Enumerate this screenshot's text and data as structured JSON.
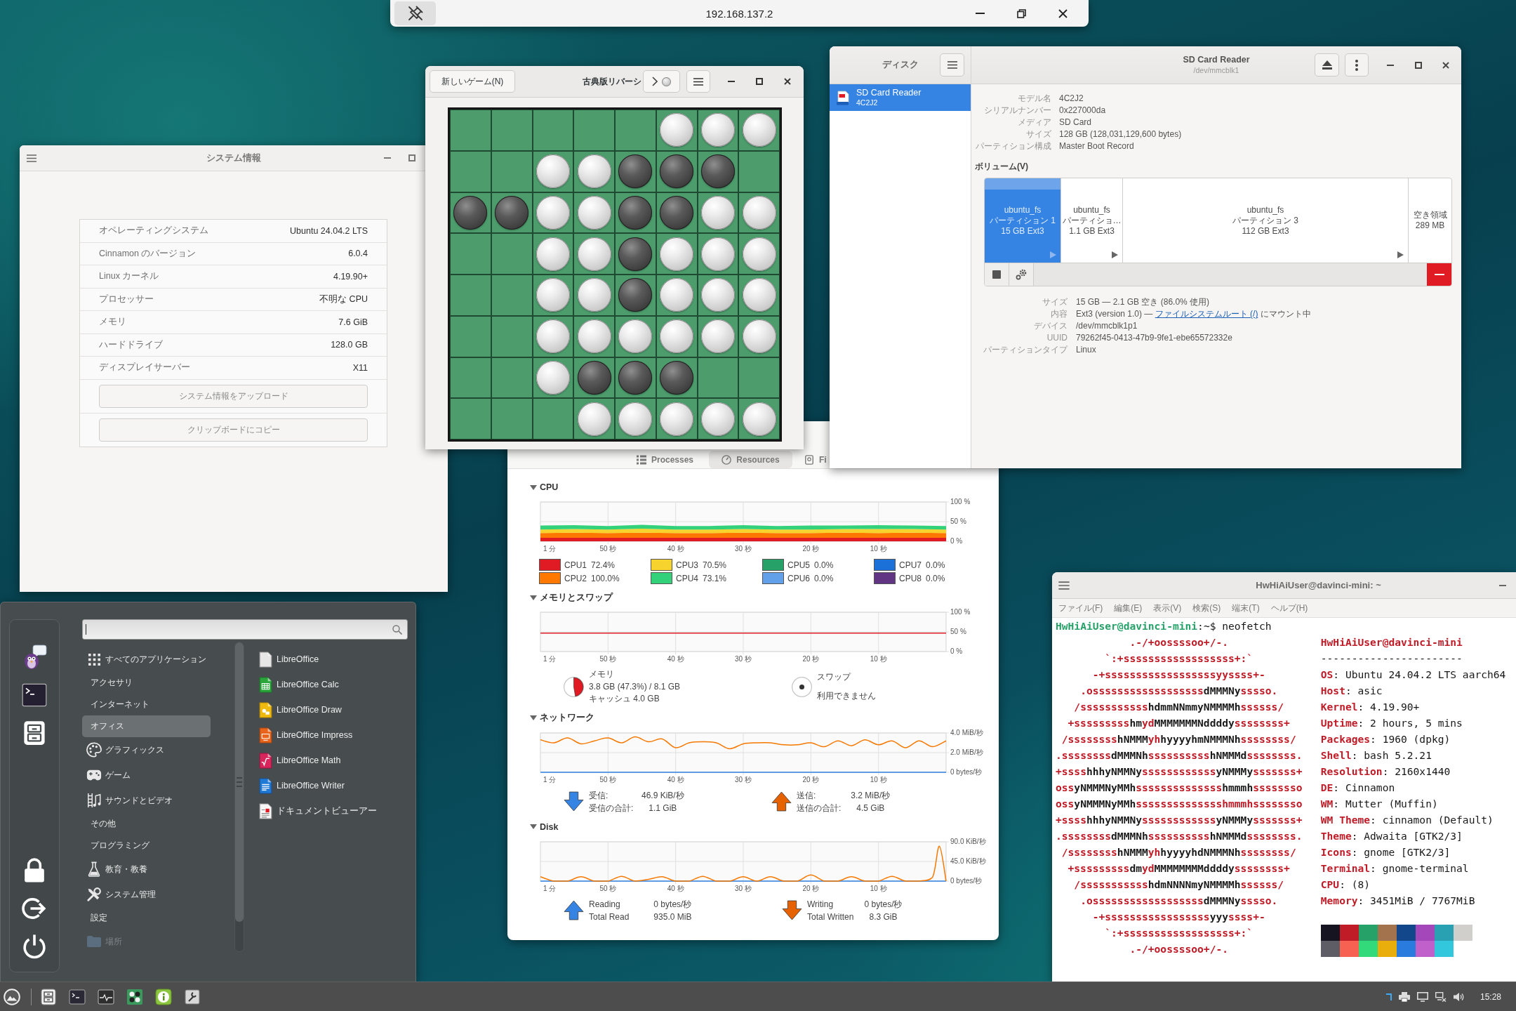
{
  "remote_bar": {
    "title": "192.168.137.2"
  },
  "system_info": {
    "title": "システム情報",
    "rows": [
      {
        "label": "オペレーティングシステム",
        "value": "Ubuntu 24.04.2 LTS"
      },
      {
        "label": "Cinnamon のバージョン",
        "value": "6.0.4"
      },
      {
        "label": "Linux カーネル",
        "value": "4.19.90+"
      },
      {
        "label": "プロセッサー",
        "value": "不明な CPU"
      },
      {
        "label": "メモリ",
        "value": "7.6 GiB"
      },
      {
        "label": "ハードドライブ",
        "value": "128.0 GB"
      },
      {
        "label": "ディスプレイサーバー",
        "value": "X11"
      }
    ],
    "buttons": [
      "システム情報をアップロード",
      "クリップボードにコピー"
    ]
  },
  "reversi": {
    "new_game_button": "新しいゲーム(N)",
    "title": "古典版リバーシ",
    "turn": {
      "kind": "white"
    },
    "board": [
      [
        {
          "kind": "empty"
        },
        {
          "kind": "empty"
        },
        {
          "kind": "empty"
        },
        {
          "kind": "empty"
        },
        {
          "kind": "empty"
        },
        {
          "kind": "white"
        },
        {
          "kind": "white"
        },
        {
          "kind": "white"
        }
      ],
      [
        {
          "kind": "empty"
        },
        {
          "kind": "empty"
        },
        {
          "kind": "white"
        },
        {
          "kind": "white"
        },
        {
          "kind": "black"
        },
        {
          "kind": "black"
        },
        {
          "kind": "black"
        },
        {
          "kind": "empty"
        }
      ],
      [
        {
          "kind": "black"
        },
        {
          "kind": "black"
        },
        {
          "kind": "white"
        },
        {
          "kind": "white"
        },
        {
          "kind": "black"
        },
        {
          "kind": "black"
        },
        {
          "kind": "white"
        },
        {
          "kind": "white"
        }
      ],
      [
        {
          "kind": "empty"
        },
        {
          "kind": "empty"
        },
        {
          "kind": "white"
        },
        {
          "kind": "white"
        },
        {
          "kind": "black"
        },
        {
          "kind": "white"
        },
        {
          "kind": "white"
        },
        {
          "kind": "white"
        }
      ],
      [
        {
          "kind": "empty"
        },
        {
          "kind": "empty"
        },
        {
          "kind": "white"
        },
        {
          "kind": "white"
        },
        {
          "kind": "black"
        },
        {
          "kind": "white"
        },
        {
          "kind": "white"
        },
        {
          "kind": "white"
        }
      ],
      [
        {
          "kind": "empty"
        },
        {
          "kind": "empty"
        },
        {
          "kind": "white"
        },
        {
          "kind": "white"
        },
        {
          "kind": "white"
        },
        {
          "kind": "white"
        },
        {
          "kind": "white"
        },
        {
          "kind": "white"
        }
      ],
      [
        {
          "kind": "empty"
        },
        {
          "kind": "empty"
        },
        {
          "kind": "white"
        },
        {
          "kind": "black"
        },
        {
          "kind": "black"
        },
        {
          "kind": "black"
        },
        {
          "kind": "empty"
        },
        {
          "kind": "empty"
        }
      ],
      [
        {
          "kind": "empty"
        },
        {
          "kind": "empty"
        },
        {
          "kind": "empty"
        },
        {
          "kind": "white"
        },
        {
          "kind": "white"
        },
        {
          "kind": "white"
        },
        {
          "kind": "white"
        },
        {
          "kind": "white"
        }
      ]
    ]
  },
  "disks": {
    "sidebar_title": "ディスク",
    "drives": [
      {
        "name": "SD Card Reader",
        "model": "4C2J2",
        "selected": true
      }
    ],
    "title": "SD Card Reader",
    "subtitle": "/dev/mmcblk1",
    "info": [
      {
        "label": "モデル名",
        "value": "4C2J2"
      },
      {
        "label": "シリアルナンバー",
        "value": "0x227000da"
      },
      {
        "label": "メディア",
        "value": "SD Card"
      },
      {
        "label": "サイズ",
        "value": "128 GB (128,031,129,600 bytes)"
      },
      {
        "label": "パーティション構成",
        "value": "Master Boot Record"
      }
    ],
    "volumes_heading": "ボリューム(V)",
    "partitions": [
      {
        "kind": "partition",
        "name": "ubuntu_fs",
        "label": "パーティション 1",
        "size": "15 GB Ext3",
        "selected": true
      },
      {
        "kind": "partition",
        "name": "ubuntu_fs",
        "label": "パーティショ…",
        "size": "1.1 GB Ext3",
        "selected": false
      },
      {
        "kind": "partition",
        "name": "ubuntu_fs",
        "label": "パーティション 3",
        "size": "112 GB Ext3",
        "selected": false
      },
      {
        "kind": "free",
        "label": "空き領域",
        "size": "289 MB",
        "selected": false
      }
    ],
    "details": [
      {
        "label": "サイズ",
        "value": "15 GB — 2.1 GB 空き (86.0% 使用)"
      },
      {
        "label": "内容",
        "value": "Ext3 (version 1.0) — ",
        "link": "ファイルシステムルート (/)",
        "suffix": " にマウント中"
      },
      {
        "label": "デバイス",
        "value": "/dev/mmcblk1p1"
      },
      {
        "label": "UUID",
        "value": "79262f45-0413-47b9-9fe1-ebe65572332e"
      },
      {
        "label": "パーティションタイプ",
        "value": "Linux"
      }
    ]
  },
  "system_monitor": {
    "tabs": [
      {
        "label": "Processes",
        "selected": false
      },
      {
        "label": "Resources",
        "selected": true
      },
      {
        "label": "Fi",
        "selected": false
      }
    ],
    "sections": [
      {
        "kind": "cpu",
        "title": "CPU",
        "expanded": true,
        "x_axis_start": "1 分",
        "chart_data": {
          "type": "area",
          "stacked": true,
          "grid": true,
          "x": [
            60,
            55,
            50,
            45,
            40,
            35,
            30,
            25,
            20,
            15,
            10,
            5,
            0
          ],
          "series": [
            {
              "color": "#33d17a",
              "values": [
                10,
                10,
                9,
                10,
                9,
                9,
                10,
                9,
                10,
                9,
                10,
                9,
                9
              ]
            },
            {
              "color": "#f6d32d",
              "values": [
                9,
                9,
                9,
                10,
                9,
                9,
                9,
                9,
                9,
                9,
                10,
                9,
                9
              ]
            },
            {
              "color": "#ff7800",
              "values": [
                12,
                13,
                12,
                13,
                12,
                12,
                13,
                12,
                12,
                13,
                12,
                13,
                12
              ]
            },
            {
              "color": "#e01b24",
              "values": [
                9,
                9,
                9,
                9,
                9,
                9,
                9,
                9,
                9,
                9,
                9,
                9,
                9
              ]
            }
          ],
          "xlim": [
            60,
            0
          ],
          "ylim": [
            0,
            100
          ],
          "xticks": [
            {
              "value": 50,
              "label": "50 秒"
            },
            {
              "value": 40,
              "label": "40 秒"
            },
            {
              "value": 30,
              "label": "30 秒"
            },
            {
              "value": 20,
              "label": "20 秒"
            },
            {
              "value": 10,
              "label": "10 秒"
            }
          ],
          "yticks": [
            {
              "value": 100,
              "label": "100 %"
            },
            {
              "value": 50,
              "label": "50 %"
            },
            {
              "value": 0,
              "label": "0 %"
            }
          ]
        },
        "legend": [
          {
            "name": "CPU1",
            "color": "#e01b24",
            "reading": "72.4%"
          },
          {
            "name": "CPU2",
            "color": "#ff7800",
            "reading": "100.0%"
          },
          {
            "name": "CPU3",
            "color": "#f6d32d",
            "reading": "70.5%"
          },
          {
            "name": "CPU4",
            "color": "#33d17a",
            "reading": "73.1%"
          },
          {
            "name": "CPU5",
            "color": "#26a269",
            "reading": "0.0%"
          },
          {
            "name": "CPU6",
            "color": "#62a0ea",
            "reading": "0.0%"
          },
          {
            "name": "CPU7",
            "color": "#1c71d8",
            "reading": "0.0%"
          },
          {
            "name": "CPU8",
            "color": "#613583",
            "reading": "0.0%"
          }
        ]
      },
      {
        "kind": "memory",
        "title": "メモリとスワップ",
        "expanded": true,
        "x_axis_start": "1 分",
        "chart_data": {
          "type": "line",
          "grid": true,
          "x": [
            60,
            0
          ],
          "series": [
            {
              "color": "#e01b24",
              "values": [
                47,
                47
              ]
            }
          ],
          "xlim": [
            60,
            0
          ],
          "ylim": [
            0,
            100
          ],
          "xticks": [
            {
              "value": 50,
              "label": "50 秒"
            },
            {
              "value": 40,
              "label": "40 秒"
            },
            {
              "value": 30,
              "label": "30 秒"
            },
            {
              "value": 20,
              "label": "20 秒"
            },
            {
              "value": 10,
              "label": "10 秒"
            }
          ],
          "yticks": [
            {
              "value": 100,
              "label": "100 %"
            },
            {
              "value": 50,
              "label": "50 %"
            },
            {
              "value": 0,
              "label": "0 %"
            }
          ]
        },
        "legend": [
          {
            "title": "メモリ",
            "lines": [
              "3.8 GB (47.3%) / 8.1 GB",
              "キャッシュ 4.0 GB"
            ],
            "level": 0.473,
            "color": "#e01b24"
          },
          {
            "title": "スワップ",
            "lines": [
              "利用できません"
            ]
          }
        ]
      },
      {
        "kind": "network",
        "title": "ネットワーク",
        "expanded": true,
        "x_axis_start": "1 分",
        "chart_data": {
          "type": "line",
          "grid": true,
          "x": [
            60,
            58,
            56,
            54,
            52,
            50,
            48,
            46,
            44,
            42,
            40,
            38,
            36,
            34,
            32,
            30,
            28,
            26,
            24,
            22,
            20,
            18,
            16,
            14,
            12,
            10,
            8,
            6,
            4,
            2,
            0
          ],
          "series": [
            {
              "color": "#3584e4",
              "values": [
                0,
                0,
                0,
                0,
                0,
                0,
                0,
                0,
                0,
                0,
                0,
                0,
                0,
                0,
                0,
                0,
                0,
                0,
                0,
                0,
                0,
                0,
                0,
                0,
                0,
                0,
                0,
                0,
                0,
                0,
                0
              ]
            },
            {
              "color": "#f57900",
              "values": [
                3.3,
                3.0,
                3.5,
                2.9,
                3.2,
                3.5,
                3.0,
                3.6,
                3.1,
                3.4,
                2.5,
                3.0,
                3.1,
                3.0,
                2.4,
                2.9,
                3.0,
                3.0,
                2.8,
                2.8,
                3.0,
                2.6,
                3.2,
                2.7,
                3.3,
                2.8,
                3.2,
                2.5,
                3.2,
                2.6,
                3.2
              ]
            }
          ],
          "xlim": [
            60,
            0
          ],
          "ylim": [
            0,
            4
          ],
          "xticks": [
            {
              "value": 50,
              "label": "50 秒"
            },
            {
              "value": 40,
              "label": "40 秒"
            },
            {
              "value": 30,
              "label": "30 秒"
            },
            {
              "value": 20,
              "label": "20 秒"
            },
            {
              "value": 10,
              "label": "10 秒"
            }
          ],
          "yticks": [
            {
              "value": 4,
              "label": "4.0 MiB/秒"
            },
            {
              "value": 2,
              "label": "2.0 MiB/秒"
            },
            {
              "value": 0,
              "label": "0 bytes/秒"
            }
          ]
        },
        "legend": [
          {
            "kind": "down",
            "color": "#3584e4",
            "rows": [
              {
                "label": "受信:",
                "value": "46.9 KiB/秒"
              },
              {
                "label": "受信の合計:",
                "value": "1.1 GiB"
              }
            ]
          },
          {
            "kind": "up",
            "color": "#e66100",
            "rows": [
              {
                "label": "送信:",
                "value": "3.2 MiB/秒"
              },
              {
                "label": "送信の合計:",
                "value": "4.5 GiB"
              }
            ]
          }
        ]
      },
      {
        "kind": "disk",
        "title": "Disk",
        "expanded": true,
        "x_axis_start": "1 分",
        "chart_data": {
          "type": "line",
          "grid": true,
          "x": [
            60,
            58,
            56,
            54,
            52,
            50,
            48,
            46,
            44,
            42,
            40,
            38,
            36,
            34,
            32,
            30,
            28,
            26,
            24,
            22,
            20,
            18,
            16,
            14,
            12,
            10,
            8,
            6,
            4,
            2,
            1,
            0
          ],
          "series": [
            {
              "color": "#3584e4",
              "values": [
                0,
                0,
                0,
                0,
                0,
                0,
                0,
                0,
                0,
                0,
                0,
                0,
                0,
                0,
                0,
                0,
                0,
                0,
                0,
                0,
                0,
                0,
                0,
                0,
                0,
                0,
                0,
                0,
                0,
                0,
                0,
                0
              ]
            },
            {
              "color": "#f57900",
              "values": [
                10,
                0,
                0,
                10,
                0,
                0,
                11,
                0,
                4,
                10,
                0,
                0,
                11,
                0,
                0,
                10,
                0,
                10,
                0,
                0,
                14,
                0,
                0,
                10,
                0,
                0,
                11,
                0,
                0,
                9,
                80,
                0
              ]
            }
          ],
          "xlim": [
            60,
            0
          ],
          "ylim": [
            0,
            90
          ],
          "xticks": [
            {
              "value": 50,
              "label": "50 秒"
            },
            {
              "value": 40,
              "label": "40 秒"
            },
            {
              "value": 30,
              "label": "30 秒"
            },
            {
              "value": 20,
              "label": "20 秒"
            },
            {
              "value": 10,
              "label": "10 秒"
            }
          ],
          "yticks": [
            {
              "value": 90,
              "label": "90.0 KiB/秒"
            },
            {
              "value": 45,
              "label": "45.0 KiB/秒"
            },
            {
              "value": 0,
              "label": "0 bytes/秒"
            }
          ]
        },
        "legend": [
          {
            "kind": "up",
            "color": "#3584e4",
            "rows": [
              {
                "label": "Reading",
                "value": "0 bytes/秒"
              },
              {
                "label": "Total Read",
                "value": "935.0 MiB"
              }
            ]
          },
          {
            "kind": "down",
            "color": "#e66100",
            "rows": [
              {
                "label": "Writing",
                "value": "0 bytes/秒"
              },
              {
                "label": "Total Written",
                "value": "8.3 GiB"
              }
            ]
          }
        ]
      }
    ]
  },
  "terminal": {
    "title": "HwHiAiUser@davinci-mini: ~",
    "menu": [
      "ファイル(F)",
      "編集(E)",
      "表示(V)",
      "検索(S)",
      "端末(T)",
      "ヘルプ(H)"
    ],
    "prompt": "**HwHiAiUser@davinci-mini**:~$",
    "command": "neofetch",
    "art": [
      ".-/+oossssoo+/-.",
      "`:+ssssssssssssssssss+:`",
      "-+ssssssssssssssssssyyssss+-",
      ".ossssssssssssssssss**dMMMNy**sssso.",
      "/sssssssssss**hdmmNNmmyNMMMMh**ssssss/",
      "+sssssssss**hm**yd**MMMMMMMNddddy**ssssssss+",
      "/ssssssss**hNMMM**yh**hyyyyhmNMMMNh**ssssssss/",
      ".ssssssss**dMMMNh**ssssssssss**hNMMMd**ssssssss.",
      "+ssss**hhhyNMMNy**ssssssssssss**yNMMMy**sssssss+",
      "oss**yNMMMNyMMh**ssssssssssssss**hmmmh**ssssssso",
      "oss**yNMMMNyMMh**sssssssssssssshmmmhssssssso",
      "+ssss**hhhyNMMNy**ssssssssssss**yNMMMy**sssssss+",
      ".ssssssss**dMMMNh**ssssssssss**hNMMMd**ssssssss.",
      "/ssssssss**hNMMM**yh**hyyyyhdNMMMNh**ssssssss/",
      "+sssssssss**dm**yd**MMMMMMMMddddy**ssssssss+",
      "/sssssssssss**hdmNNNNmyNMMMMh**ssssss/",
      ".ossssssssssssssssss**dMMMNy**sssso.",
      "-+sssssssssssssssss**yyy**ssss+-",
      "`:+ssssssssssssssssss+:`",
      ".-/+oossssoo+/-."
    ],
    "info": {
      "title": "HwHiAiUser@davinci-mini",
      "separator": "-----------------------",
      "fields": [
        "**OS**: Ubuntu 24.04.2 LTS aarch64",
        "**Host**: asic",
        "**Kernel**: 4.19.90+",
        "**Uptime**: 2 hours, 5 mins",
        "**Packages**: 1960 (dpkg)",
        "**Shell**: bash 5.2.21",
        "**Resolution**: 2160x1440",
        "**DE**: Cinnamon",
        "**WM**: Mutter (Muffin)",
        "**WM Theme**: cinnamon (Default)",
        "**Theme**: Adwaita [GTK2/3]",
        "**Icons**: gnome [GTK2/3]",
        "**Terminal**: gnome-terminal",
        "**CPU**: (8)",
        "**Memory**: 3451MiB / 7767MiB"
      ]
    },
    "palette": [
      {
        "color": "#171421"
      },
      {
        "color": "#c01c28"
      },
      {
        "color": "#26a269"
      },
      {
        "color": "#a2734c"
      },
      {
        "color": "#12488b"
      },
      {
        "color": "#a347ba"
      },
      {
        "color": "#2aa1b3"
      },
      {
        "color": "#d0cfcc"
      },
      {
        "color": "#5e5c64"
      },
      {
        "color": "#f66151"
      },
      {
        "color": "#33da7a"
      },
      {
        "color": "#e9ad0c"
      },
      {
        "color": "#2a7bde"
      },
      {
        "color": "#c061cb"
      },
      {
        "color": "#33c7de"
      }
    ]
  },
  "menu": {
    "categories": [
      {
        "label": "すべてのアプリケーション",
        "kind": "grid",
        "selected": false,
        "disabled": false
      },
      {
        "label": "アクセサリ",
        "kind": "plain",
        "selected": false,
        "disabled": false
      },
      {
        "label": "インターネット",
        "kind": "plain",
        "selected": false,
        "disabled": false
      },
      {
        "label": "オフィス",
        "kind": "plain",
        "selected": true,
        "disabled": false
      },
      {
        "label": "グラフィックス",
        "kind": "palette",
        "selected": false,
        "disabled": false
      },
      {
        "label": "ゲーム",
        "kind": "gamepad",
        "selected": false,
        "disabled": false
      },
      {
        "label": "サウンドとビデオ",
        "kind": "media",
        "selected": false,
        "disabled": false
      },
      {
        "label": "その他",
        "kind": "plain",
        "selected": false,
        "disabled": false
      },
      {
        "label": "プログラミング",
        "kind": "plain",
        "selected": false,
        "disabled": false
      },
      {
        "label": "教育・教養",
        "kind": "flask",
        "selected": false,
        "disabled": false
      },
      {
        "label": "システム管理",
        "kind": "tools",
        "selected": false,
        "disabled": false
      },
      {
        "label": "設定",
        "kind": "plain",
        "selected": false,
        "disabled": false
      },
      {
        "label": "場所",
        "kind": "folder",
        "selected": false,
        "disabled": true
      }
    ],
    "apps": [
      {
        "label": "LibreOffice",
        "kind": "suite"
      },
      {
        "label": "LibreOffice Calc",
        "kind": "calc"
      },
      {
        "label": "LibreOffice Draw",
        "kind": "draw"
      },
      {
        "label": "LibreOffice Impress",
        "kind": "impress"
      },
      {
        "label": "LibreOffice Math",
        "kind": "math"
      },
      {
        "label": "LibreOffice Writer",
        "kind": "writer"
      },
      {
        "label": "ドキュメントビューアー",
        "kind": "viewer"
      }
    ]
  },
  "taskbar": {
    "clock": "15:28"
  }
}
